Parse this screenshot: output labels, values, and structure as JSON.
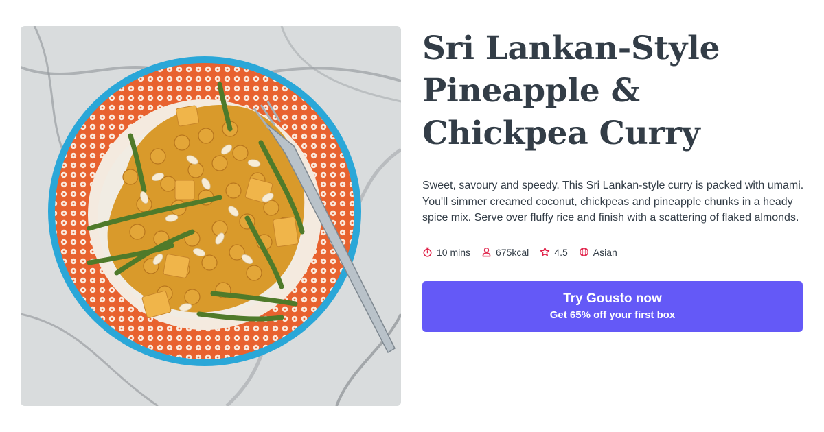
{
  "recipe": {
    "title": "Sri Lankan-Style Pineapple & Chickpea Curry",
    "description": "Sweet, savoury and speedy. This Sri Lankan-style curry is packed with umami. You'll simmer creamed coconut, chickpeas and pineapple chunks in a heady spice mix. Serve over fluffy rice and finish with a scattering of flaked almonds.",
    "meta": {
      "time": "10 mins",
      "calories": "675kcal",
      "rating": "4.5",
      "cuisine": "Asian"
    },
    "icons": [
      "timer-icon",
      "person-icon",
      "star-icon",
      "globe-icon"
    ]
  },
  "cta": {
    "title": "Try Gousto now",
    "subtitle": "Get 65% off your first box"
  },
  "colors": {
    "accent": "#6459f7",
    "icon": "#e0234a",
    "text": "#333d47"
  }
}
